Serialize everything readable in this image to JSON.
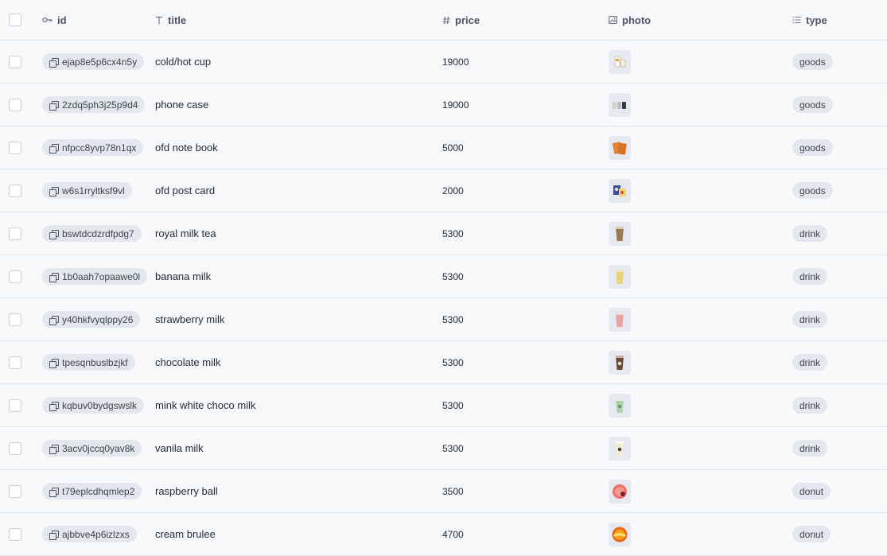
{
  "header": {
    "id": "id",
    "title": "title",
    "price": "price",
    "photo": "photo",
    "type": "type"
  },
  "rows": [
    {
      "id": "ejap8e5p6cx4n5y",
      "title": "cold/hot cup",
      "price": "19000",
      "type": "goods",
      "photo_icon": "cup-photo-icon"
    },
    {
      "id": "2zdq5ph3j25p9d4",
      "title": "phone case",
      "price": "19000",
      "type": "goods",
      "photo_icon": "phone-case-photo-icon"
    },
    {
      "id": "nfpcc8yvp78n1qx",
      "title": "ofd note book",
      "price": "5000",
      "type": "goods",
      "photo_icon": "notebook-photo-icon"
    },
    {
      "id": "w6s1rryltksf9vl",
      "title": "ofd post card",
      "price": "2000",
      "type": "goods",
      "photo_icon": "postcard-photo-icon"
    },
    {
      "id": "bswtdcdzrdfpdg7",
      "title": "royal milk tea",
      "price": "5300",
      "type": "drink",
      "photo_icon": "milk-tea-photo-icon"
    },
    {
      "id": "1b0aah7opaawe0l",
      "title": "banana milk",
      "price": "5300",
      "type": "drink",
      "photo_icon": "banana-milk-photo-icon"
    },
    {
      "id": "y40hkfvyqlppy26",
      "title": "strawberry milk",
      "price": "5300",
      "type": "drink",
      "photo_icon": "strawberry-milk-photo-icon"
    },
    {
      "id": "tpesqnbuslbzjkf",
      "title": "chocolate milk",
      "price": "5300",
      "type": "drink",
      "photo_icon": "chocolate-milk-photo-icon"
    },
    {
      "id": "kqbuv0bydgswslk",
      "title": "mink white choco milk",
      "price": "5300",
      "type": "drink",
      "photo_icon": "mint-choco-milk-photo-icon"
    },
    {
      "id": "3acv0jccq0yav8k",
      "title": "vanila milk",
      "price": "5300",
      "type": "drink",
      "photo_icon": "vanilla-milk-photo-icon"
    },
    {
      "id": "t79eplcdhqmlep2",
      "title": "raspberry ball",
      "price": "3500",
      "type": "donut",
      "photo_icon": "raspberry-donut-photo-icon"
    },
    {
      "id": "ajbbve4p6izlzxs",
      "title": "cream brulee",
      "price": "4700",
      "type": "donut",
      "photo_icon": "cream-donut-photo-icon"
    }
  ],
  "colors": {
    "background": "#f8f9fb",
    "pill": "#e3e7ee",
    "divider": "#e2e6ee"
  }
}
